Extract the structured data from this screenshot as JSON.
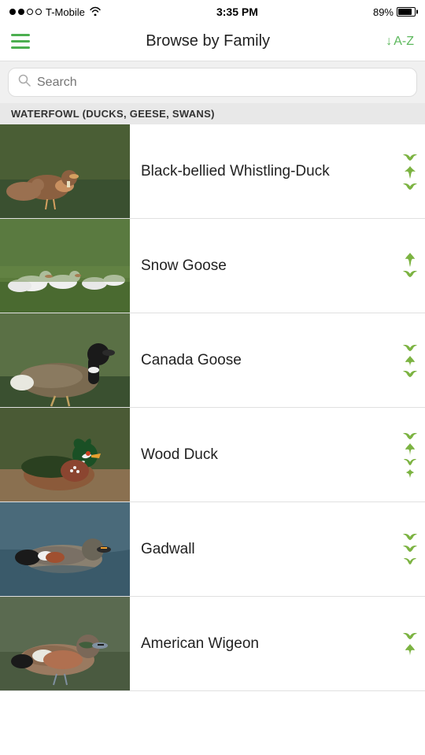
{
  "status": {
    "carrier": "T-Mobile",
    "time": "3:35 PM",
    "battery": "89%"
  },
  "header": {
    "title": "Browse by Family",
    "sort_label": "A-Z"
  },
  "search": {
    "placeholder": "Search"
  },
  "section": {
    "title": "WATERFOWL (DUCKS, GEESE, SWANS)"
  },
  "birds": [
    {
      "name": "Black-bellied Whistling-Duck",
      "photo_class": "whistling-duck"
    },
    {
      "name": "Snow Goose",
      "photo_class": "snow-goose"
    },
    {
      "name": "Canada Goose",
      "photo_class": "canada-goose"
    },
    {
      "name": "Wood Duck",
      "photo_class": "wood-duck"
    },
    {
      "name": "Gadwall",
      "photo_class": "gadwall"
    },
    {
      "name": "American Wigeon",
      "photo_class": "american-wigeon"
    }
  ]
}
